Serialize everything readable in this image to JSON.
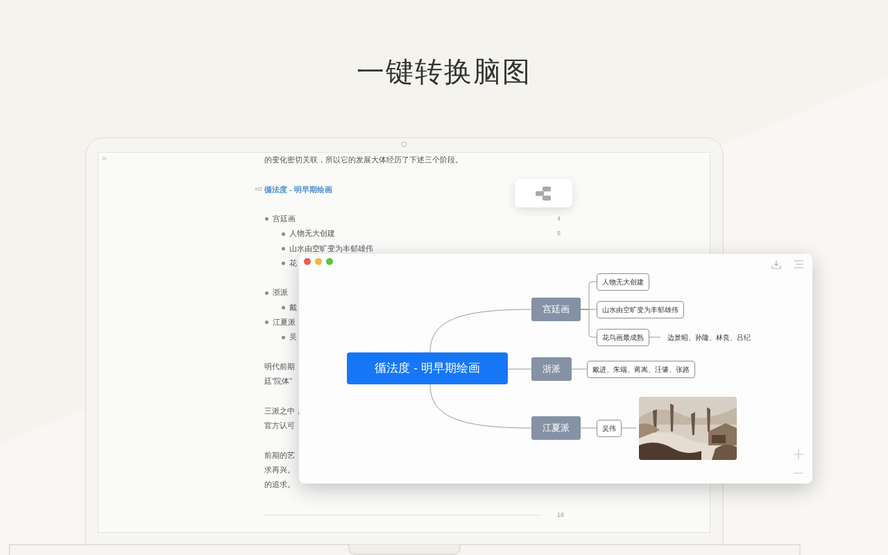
{
  "headline": "一键转换脑图",
  "editor": {
    "sidebar_toggle": "»",
    "blocks": [
      {
        "kind": "paragraph",
        "lines": [
          "的变化密切关联，所以它的发展大体经历了下述三个阶段。"
        ]
      },
      {
        "kind": "heading",
        "level_label": "H2",
        "text": "循法度 - 明早期绘画"
      },
      {
        "kind": "list",
        "items": [
          {
            "text": "宫廷画",
            "line_number": "4",
            "children": [
              {
                "text": "人物无大创建",
                "line_number": "5"
              },
              {
                "text": "山水由空旷变为丰郁雄伟"
              },
              {
                "text": "花"
              }
            ]
          },
          {
            "text": "浙派",
            "children": [
              {
                "text": "戴"
              }
            ]
          },
          {
            "text": "江夏派",
            "children": [
              {
                "text": "吴"
              }
            ]
          }
        ]
      },
      {
        "kind": "paragraph",
        "lines": [
          "明代前期",
          "廷“院体”"
        ]
      },
      {
        "kind": "paragraph",
        "lines": [
          "三派之中，",
          "官方认可"
        ]
      },
      {
        "kind": "paragraph",
        "lines": [
          "前期的艺",
          "求再兴。",
          "的追求。"
        ]
      },
      {
        "kind": "rule",
        "line_number": "16"
      }
    ]
  },
  "mindmap": {
    "root": "循法度 - 明早期绘画",
    "branches": [
      {
        "text": "宫廷画",
        "children": [
          {
            "kind": "topic",
            "text": "人物无大创建"
          },
          {
            "kind": "topic",
            "text": "山水由空旷变为丰郁雄伟"
          },
          {
            "kind": "topic",
            "text": "花鸟画最成熟",
            "children": [
              {
                "kind": "label",
                "text": "边景昭、孙隆、林良、吕纪"
              }
            ]
          }
        ]
      },
      {
        "text": "浙派",
        "children": [
          {
            "kind": "topic",
            "text": "戴进、朱端、蒋嵩、汪肇、张路"
          }
        ]
      },
      {
        "text": "江夏派",
        "children": [
          {
            "kind": "topic",
            "text": "吴伟"
          }
        ]
      }
    ]
  }
}
